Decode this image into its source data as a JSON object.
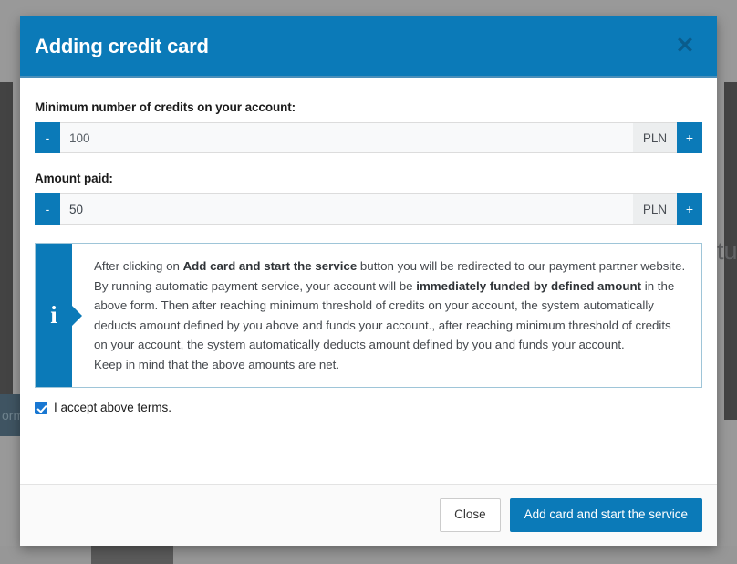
{
  "background": {
    "left_button_text": "orm",
    "right_text": "tu"
  },
  "modal": {
    "title": "Adding credit card",
    "close_icon": "close-icon",
    "close_glyph": "✕",
    "fields": [
      {
        "label": "Minimum number of credits on your account:",
        "decrement_label": "-",
        "increment_label": "+",
        "value": "100",
        "currency": "PLN",
        "focused": false
      },
      {
        "label": "Amount paid:",
        "decrement_label": "-",
        "increment_label": "+",
        "value": "50",
        "currency": "PLN",
        "focused": true
      }
    ],
    "alert": {
      "icon": "info-icon",
      "icon_glyph": "i",
      "paragraph1_pre": "After clicking on ",
      "paragraph1_bold1": "Add card and start the service",
      "paragraph1_mid": " button you will be redirected to our payment partner website. By running automatic payment service, your account will be ",
      "paragraph1_bold2": "immediately funded by defined amount",
      "paragraph1_post": " in the above form. Then after reaching minimum threshold of credits on your account, the system automatically deducts amount defined by you above and funds your account., after reaching minimum threshold of credits on your account, the system automatically deducts amount defined by you and funds your account.",
      "paragraph2": "Keep in mind that the above amounts are net."
    },
    "terms": {
      "checked": true,
      "label": "I accept above terms."
    },
    "footer": {
      "close_label": "Close",
      "submit_label": "Add card and start the service"
    }
  },
  "colors": {
    "brand_blue": "#0b7ab8",
    "header_rule": "#4a8fba",
    "alert_border": "#9ec5d8",
    "checkbox_blue": "#1877d2"
  }
}
